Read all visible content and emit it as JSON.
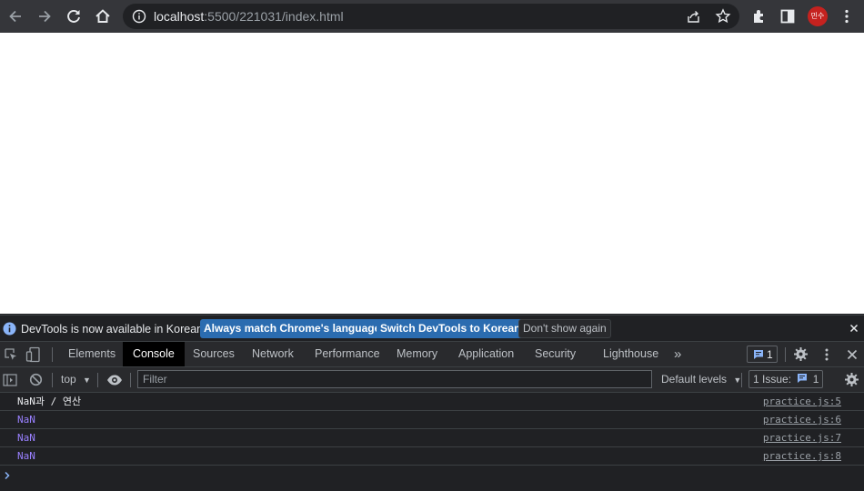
{
  "browser": {
    "url_host": "localhost",
    "url_path": ":5500/221031/index.html",
    "avatar_text": "민수",
    "icons": [
      "back-icon",
      "forward-icon",
      "reload-icon",
      "home-icon",
      "info-icon",
      "share-icon",
      "bookmark-star-icon",
      "extensions-icon",
      "side-panel-icon",
      "profile-avatar",
      "menu-kebab-icon"
    ]
  },
  "infobar": {
    "message": "DevTools is now available in Korean!",
    "btn_match": "Always match Chrome's language",
    "btn_switch": "Switch DevTools to Korean",
    "btn_dismiss": "Don't show again"
  },
  "tabs": {
    "elements": "Elements",
    "console": "Console",
    "sources": "Sources",
    "network": "Network",
    "performance": "Performance",
    "memory": "Memory",
    "application": "Application",
    "security": "Security",
    "lighthouse": "Lighthouse",
    "more": "»",
    "issues_count": "1"
  },
  "console_toolbar": {
    "context": "top",
    "filter_placeholder": "Filter",
    "levels": "Default levels",
    "issues_label": "1 Issue:",
    "issues_count": "1"
  },
  "messages": [
    {
      "text": "NaN과 / 연산",
      "source": "practice.js:5"
    },
    {
      "text": "NaN",
      "source": "practice.js:6"
    },
    {
      "text": "NaN",
      "source": "practice.js:7"
    },
    {
      "text": "NaN",
      "source": "practice.js:8"
    }
  ],
  "colors": {
    "accent_button": "#2b6cb0",
    "nan_value": "#9980ff",
    "prompt": "#8ab4f8"
  }
}
